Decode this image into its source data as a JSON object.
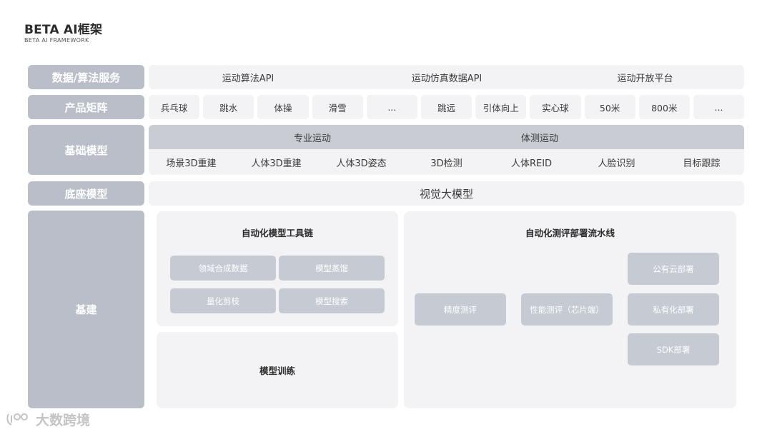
{
  "header": {
    "title": "BETA AI框架",
    "subtitle": "BETA AI FRAMEWORK"
  },
  "rows": {
    "data_service": {
      "label": "数据/算法服务",
      "items": [
        "运动算法API",
        "运动仿真数据API",
        "运动开放平台"
      ]
    },
    "products": {
      "label": "产品矩阵",
      "items": [
        "兵乓球",
        "跳水",
        "体操",
        "滑雪",
        "...",
        "跳远",
        "引体向上",
        "实心球",
        "50米",
        "800米",
        "..."
      ]
    },
    "base_model": {
      "label": "基础模型",
      "categories": [
        "专业运动",
        "体测运动"
      ],
      "items": [
        "场景3D重建",
        "人体3D重建",
        "人体3D姿态",
        "3D检测",
        "人体REID",
        "人脸识别",
        "目标跟踪"
      ]
    },
    "foundation_model": {
      "label": "底座模型",
      "value": "视觉大模型"
    },
    "infrastructure": {
      "label": "基建",
      "toolchain": {
        "title": "自动化模型工具链",
        "chips": [
          "领域合成数据",
          "模型蒸馏",
          "量化剪枝",
          "模型搜索"
        ]
      },
      "training": {
        "title": "模型训练"
      },
      "pipeline": {
        "title": "自动化测评部署流水线",
        "chips": {
          "precision": "精度测评",
          "performance": "性能测评（芯片端）",
          "public_cloud": "公有云部署",
          "private": "私有化部署",
          "sdk": "SDK部署"
        }
      }
    }
  },
  "watermark": {
    "text": "大数跨境"
  }
}
